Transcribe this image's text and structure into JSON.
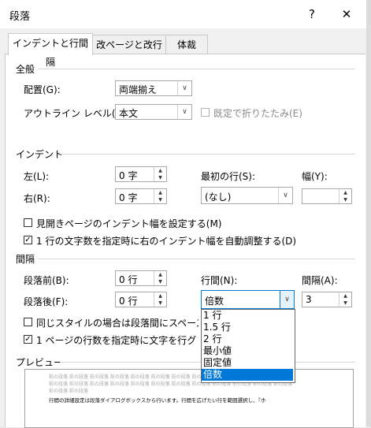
{
  "dialog": {
    "title": "段落",
    "help_label": "?",
    "close_label": "✕"
  },
  "tabs": [
    {
      "label": "インデントと行間隔",
      "active": true
    },
    {
      "label": "改ページと改行",
      "active": false
    },
    {
      "label": "体裁",
      "active": false
    }
  ],
  "general": {
    "heading": "全般",
    "alignment_label": "配置(G):",
    "alignment_value": "両端揃え",
    "outline_label": "アウトライン レベル(O):",
    "outline_value": "本文",
    "collapse_label": "既定で折りたたみ(E)"
  },
  "indent": {
    "heading": "インデント",
    "left_label": "左(L):",
    "left_value": "0 字",
    "right_label": "右(R):",
    "right_value": "0 字",
    "first_line_label": "最初の行(S):",
    "first_line_value": "(なし)",
    "width_label": "幅(Y):",
    "width_value": "",
    "mirror_label": "見開きページのインデント幅を設定する(M)",
    "mirror_checked": false,
    "auto_adjust_label": "1 行の文字数を指定時に右のインデント幅を自動調整する(D)",
    "auto_adjust_checked": true
  },
  "spacing": {
    "heading": "間隔",
    "before_label": "段落前(B):",
    "before_value": "0 行",
    "after_label": "段落後(F):",
    "after_value": "0 行",
    "line_spacing_label": "行間(N):",
    "line_spacing_value": "倍数",
    "at_label": "間隔(A):",
    "at_value": "3",
    "no_space_label": "同じスタイルの場合は段落間にスペースを追加",
    "no_space_checked": false,
    "snap_grid_label": "1 ページの行数を指定時に文字を行グリッド",
    "snap_grid_checked": true
  },
  "line_spacing_options": [
    {
      "label": "1 行",
      "selected": false
    },
    {
      "label": "1.5 行",
      "selected": false
    },
    {
      "label": "2 行",
      "selected": false
    },
    {
      "label": "最小値",
      "selected": false
    },
    {
      "label": "固定値",
      "selected": false
    },
    {
      "label": "倍数",
      "selected": true
    }
  ],
  "preview": {
    "heading": "プレビュー",
    "lines": [
      "前の段落 前の段落 前の段落 前の段落 前の段落 前の段落 前の段落 前の段落 前の段落 前の段落 前の段落 前の段落",
      "前の段落 前の段落 前の段落 前の段落 前の段落 前の段落 前の段落 前の段落 前の段落 前の段落 前の段落 前の段落",
      "前の段落 前の段落",
      "行間の詳細設定は段落ダイアログボックスから行います。行間を広げたい行を範囲選択し、『ホ"
    ]
  },
  "colors": {
    "selection": "#0078d7",
    "dialog_bg": "#f0f0f0",
    "panel_bg": "#ffffff"
  }
}
